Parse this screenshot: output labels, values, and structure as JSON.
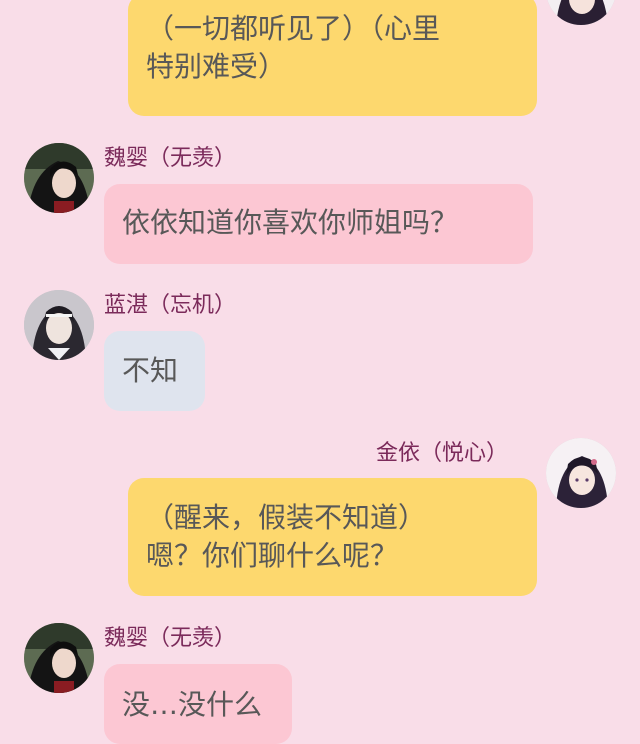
{
  "messages": [
    {
      "side": "right",
      "lines": [
        "（一切都听见了）（心里",
        "特别难受）"
      ],
      "avatar": "jin-yi-avatar"
    },
    {
      "side": "left",
      "sender": "魏婴（无羡）",
      "lines": [
        "依依知道你喜欢你师姐吗？"
      ],
      "avatar": "wei-ying-avatar"
    },
    {
      "side": "left",
      "sender": "蓝湛（忘机）",
      "lines": [
        "不知"
      ],
      "avatar": "lan-zhan-avatar"
    },
    {
      "side": "right",
      "sender": "金依（悦心）",
      "lines": [
        "（醒来，假装不知道）",
        "嗯？你们聊什么呢？"
      ],
      "avatar": "jin-yi-avatar"
    },
    {
      "side": "left",
      "sender": "魏婴（无羡）",
      "lines": [
        "没…没什么"
      ],
      "avatar": "wei-ying-avatar"
    }
  ],
  "colors": {
    "background": "#f9dde8",
    "right_bubble": "#fdd86e",
    "wei_bubble": "#fcc7d3",
    "lan_bubble": "#dfe4ee",
    "name_text": "#7b2a5a"
  }
}
